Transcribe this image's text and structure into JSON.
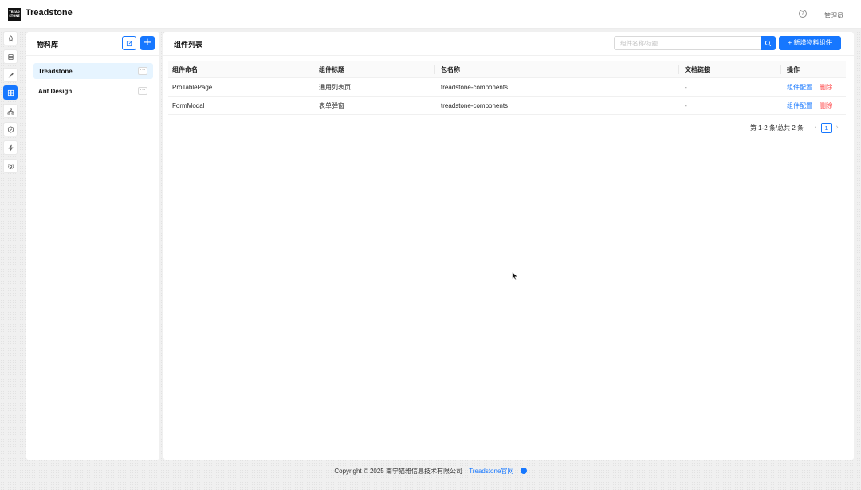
{
  "header": {
    "logo_text": "TREAD STONE",
    "app_title": "Treadstone",
    "user_name": "管理员"
  },
  "rail": {
    "items": [
      "rocket-icon",
      "database-icon",
      "tool-icon",
      "apps-icon",
      "tree-icon",
      "shield-icon",
      "bolt-icon",
      "settings-icon"
    ],
    "active_index": 3
  },
  "library": {
    "title": "物料库",
    "items": [
      {
        "label": "Treadstone",
        "selected": true
      },
      {
        "label": "Ant Design",
        "selected": false
      }
    ],
    "more_label": "···"
  },
  "components": {
    "title": "组件列表",
    "search_placeholder": "组件名称/标题",
    "new_button_label": "+ 新增物料组件",
    "columns": [
      "组件命名",
      "组件标题",
      "包名称",
      "文档链接",
      "操作"
    ],
    "rows": [
      {
        "name": "ProTablePage",
        "title": "通用列表页",
        "package": "treadstone-components",
        "doc": "-",
        "config": "组件配置",
        "delete": "删除"
      },
      {
        "name": "FormModal",
        "title": "表单弹窗",
        "package": "treadstone-components",
        "doc": "-",
        "config": "组件配置",
        "delete": "删除"
      }
    ],
    "pagination": {
      "total_text": "第 1-2 条/总共 2 条",
      "current_page": "1",
      "prev": "‹",
      "next": "›"
    }
  },
  "footer": {
    "copyright": "Copyright © 2025 南宁猫雅信息技术有限公司",
    "link_text": "Treadstone官网"
  },
  "colors": {
    "primary": "#1677ff",
    "danger": "#ff4d4f",
    "selected_bg": "#e6f4ff"
  }
}
